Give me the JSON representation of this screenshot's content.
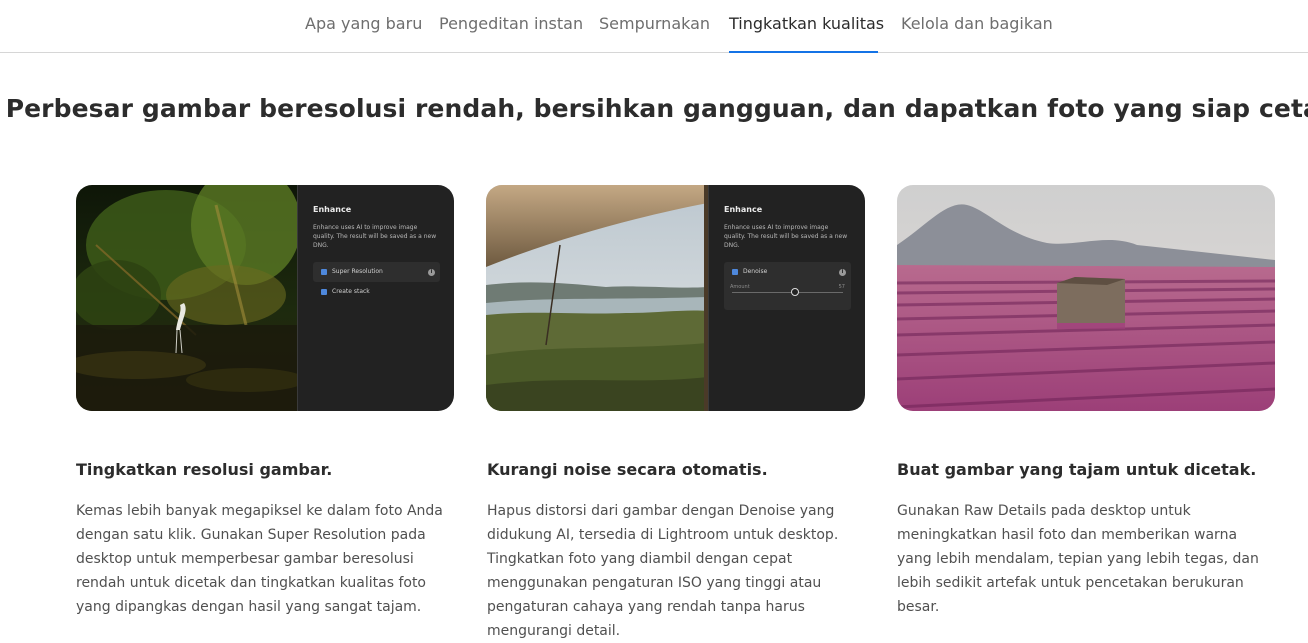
{
  "tabs": [
    {
      "label": "Apa yang baru",
      "active": false
    },
    {
      "label": "Pengeditan instan",
      "active": false
    },
    {
      "label": "Sempurnakan",
      "active": false
    },
    {
      "label": "Tingkatkan kualitas",
      "active": true
    },
    {
      "label": "Kelola dan bagikan",
      "active": false
    }
  ],
  "headline": "Perbesar gambar beresolusi rendah, bersihkan gangguan, dan dapatkan foto yang siap cetak.",
  "cards": [
    {
      "title": "Tingkatkan resolusi gambar.",
      "body": "Kemas lebih banyak megapiksel ke dalam foto Anda dengan satu klik. Gunakan Super Resolution pada desktop untuk memperbesar gambar beresolusi rendah untuk dicetak dan tingkatkan kualitas foto yang dipangkas dengan hasil yang sangat tajam.",
      "panel": {
        "title": "Enhance",
        "description": "Enhance uses AI to improve image quality. The result will be saved as a new DNG.",
        "options": [
          "Super Resolution",
          "Create stack"
        ]
      }
    },
    {
      "title": "Kurangi noise secara otomatis.",
      "body": "Hapus distorsi dari gambar dengan Denoise yang didukung AI, tersedia di Lightroom untuk desktop. Tingkatkan foto yang diambil dengan cepat menggunakan pengaturan ISO yang tinggi atau pengaturan cahaya yang rendah tanpa harus mengurangi detail.",
      "panel": {
        "title": "Enhance",
        "description": "Enhance uses AI to improve image quality. The result will be saved as a new DNG.",
        "option": "Denoise",
        "slider_label": "Amount",
        "slider_value": "57"
      }
    },
    {
      "title": "Buat gambar yang tajam untuk dicetak.",
      "body": "Gunakan Raw Details pada desktop untuk meningkatkan hasil foto dan memberikan warna yang lebih mendalam, tepian yang lebih tegas, dan lebih sedikit artefak untuk pencetakan berukuran besar."
    }
  ],
  "colors": {
    "accent": "#1473e6",
    "panel_bg": "#222222",
    "text": "#2c2c2c"
  }
}
